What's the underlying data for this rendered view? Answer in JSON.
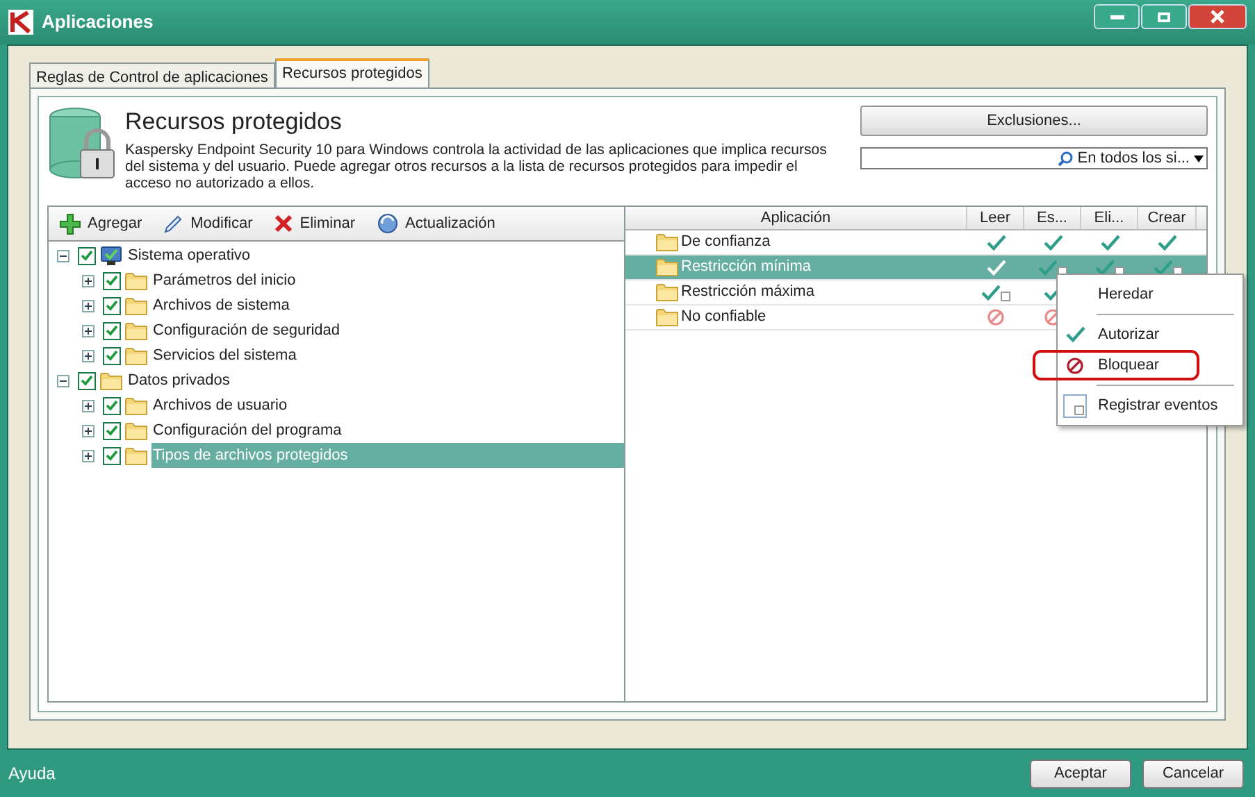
{
  "window": {
    "title": "Aplicaciones"
  },
  "tabs": [
    {
      "label": "Reglas de Control de aplicaciones",
      "selected": false
    },
    {
      "label": "Recursos protegidos",
      "selected": true
    }
  ],
  "header": {
    "title": "Recursos protegidos",
    "description": "Kaspersky Endpoint Security 10 para Windows controla la actividad de las aplicaciones que implica recursos del sistema y del usuario. Puede agregar otros recursos a la lista de recursos protegidos para impedir el acceso no autorizado a ellos.",
    "exclusions_button": "Exclusiones...",
    "search_scope": "En todos los si..."
  },
  "toolbar": [
    {
      "kind": "add",
      "label": "Agregar"
    },
    {
      "kind": "edit",
      "label": "Modificar"
    },
    {
      "kind": "delete",
      "label": "Eliminar"
    },
    {
      "kind": "update",
      "label": "Actualización"
    }
  ],
  "tree": [
    {
      "label": "Sistema operativo",
      "kind": "computer",
      "checked": true,
      "expanded": true,
      "selected": false,
      "children": [
        {
          "label": "Parámetros del inicio",
          "kind": "folder",
          "checked": true,
          "expanded": false,
          "selected": false
        },
        {
          "label": "Archivos de sistema",
          "kind": "folder",
          "checked": true,
          "expanded": false,
          "selected": false
        },
        {
          "label": "Configuración de seguridad",
          "kind": "folder",
          "checked": true,
          "expanded": false,
          "selected": false
        },
        {
          "label": "Servicios del sistema",
          "kind": "folder",
          "checked": true,
          "expanded": false,
          "selected": false
        }
      ]
    },
    {
      "label": "Datos privados",
      "kind": "folder",
      "checked": true,
      "expanded": true,
      "selected": false,
      "children": [
        {
          "label": "Archivos de usuario",
          "kind": "folder",
          "checked": true,
          "expanded": false,
          "selected": false
        },
        {
          "label": "Configuración del programa",
          "kind": "folder",
          "checked": true,
          "expanded": false,
          "selected": false
        },
        {
          "label": "Tipos de archivos protegidos",
          "kind": "folder",
          "checked": true,
          "expanded": false,
          "selected": true
        }
      ]
    }
  ],
  "table": {
    "columns": [
      "Aplicación",
      "Leer",
      "Es...",
      "Eli...",
      "Crear"
    ],
    "rows": [
      {
        "name": "De confianza",
        "selected": false,
        "cells": [
          {
            "kind": "allow"
          },
          {
            "kind": "allow"
          },
          {
            "kind": "allow"
          },
          {
            "kind": "allow"
          }
        ]
      },
      {
        "name": "Restricción mínima",
        "selected": true,
        "cells": [
          {
            "kind": "allow"
          },
          {
            "kind": "allow_log"
          },
          {
            "kind": "allow_log"
          },
          {
            "kind": "allow_log"
          }
        ]
      },
      {
        "name": "Restricción máxima",
        "selected": false,
        "cells": [
          {
            "kind": "allow_log"
          },
          {
            "kind": "allow"
          }
        ]
      },
      {
        "name": "No confiable",
        "selected": false,
        "cells": [
          {
            "kind": "block"
          },
          {
            "kind": "block"
          }
        ]
      }
    ]
  },
  "context_menu": [
    {
      "kind": "inherit",
      "label": "Heredar",
      "outlined": false
    },
    {
      "kind": "allow",
      "label": "Autorizar",
      "outlined": false
    },
    {
      "kind": "block",
      "label": "Bloquear",
      "outlined": true
    },
    {
      "kind": "log",
      "label": "Registrar eventos",
      "outlined": false
    }
  ],
  "footer": {
    "help": "Ayuda",
    "buttons": [
      "Aceptar",
      "Cancelar"
    ]
  }
}
